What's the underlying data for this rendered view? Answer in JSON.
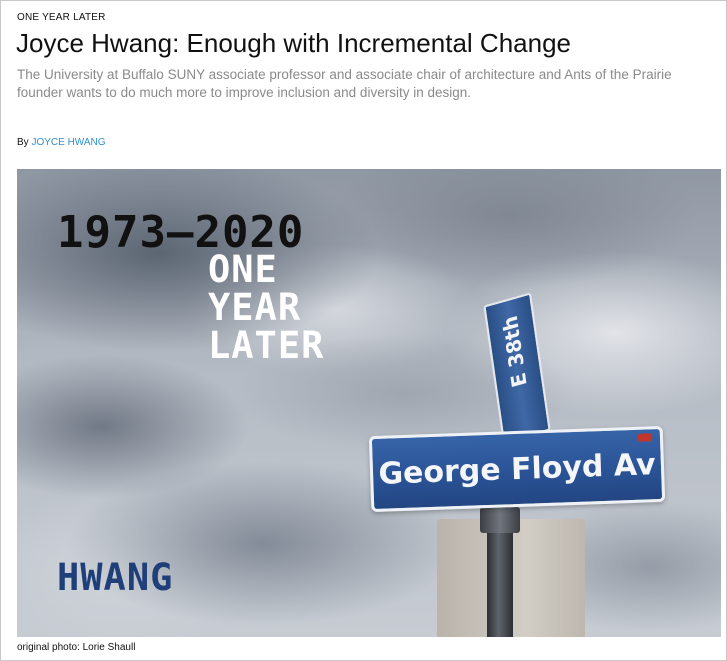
{
  "article": {
    "kicker": "ONE YEAR LATER",
    "headline": "Joyce Hwang: Enough with Incremental Change",
    "dek": "The University at Buffalo SUNY associate professor and associate chair of architecture and Ants of the Prairie founder wants to do much more to improve inclusion and diversity in design.",
    "byline_prefix": "By",
    "author": "JOYCE HWANG"
  },
  "hero": {
    "years": "1973–2020",
    "later_lines": [
      "ONE",
      "YEAR",
      "LATER"
    ],
    "name": "HWANG",
    "street_sign": "George Floyd Av",
    "vertical_sign": "E 38th",
    "caption": "original photo: Lorie Shaull"
  },
  "colors": {
    "author_link": "#2f8fd6",
    "name_overlay": "#1f3f79",
    "sign_blue": "#2a5396"
  }
}
